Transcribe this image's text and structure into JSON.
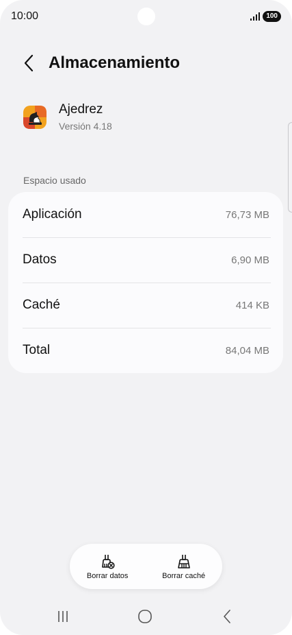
{
  "status_bar": {
    "time": "10:00",
    "battery": "100"
  },
  "header": {
    "title": "Almacenamiento",
    "back_icon": "chevron-left-icon"
  },
  "app": {
    "name": "Ajedrez",
    "version": "Versión 4.18",
    "icon": "chess-app-icon"
  },
  "storage": {
    "section_label": "Espacio usado",
    "rows": [
      {
        "label": "Aplicación",
        "value": "76,73 MB"
      },
      {
        "label": "Datos",
        "value": "6,90 MB"
      },
      {
        "label": "Caché",
        "value": "414 KB"
      },
      {
        "label": "Total",
        "value": "84,04 MB"
      }
    ]
  },
  "actions": {
    "clear_data": {
      "label": "Borrar datos",
      "icon": "broom-clear-data-icon"
    },
    "clear_cache": {
      "label": "Borrar caché",
      "icon": "broom-icon"
    }
  },
  "nav": {
    "recents_icon": "recents-icon",
    "home_icon": "home-icon",
    "back_icon": "back-icon"
  },
  "colors": {
    "background": "#f2f2f4",
    "card": "#fbfbfd",
    "text_primary": "#111111",
    "text_secondary": "#777777",
    "app_icon_orange": "#f2a21e",
    "app_icon_red": "#d9482b"
  }
}
